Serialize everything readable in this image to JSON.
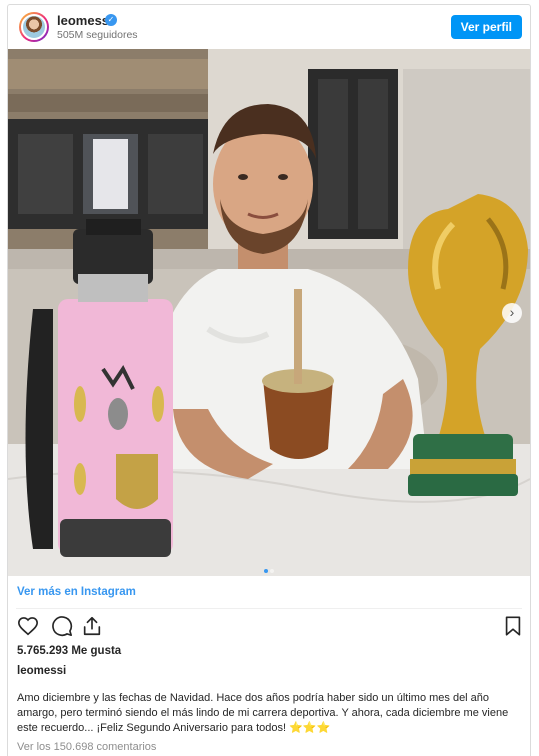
{
  "header": {
    "username": "leomessi",
    "verified_mark": "✓",
    "followers": "505M seguidores",
    "view_profile_label": "Ver perfil"
  },
  "photo": {
    "carousel_next": "›",
    "carousel_total": 2,
    "carousel_index": 1
  },
  "footer": {
    "view_more_label": "Ver más en Instagram",
    "likes": "5.765.293 Me gusta",
    "caption_username": "leomessi",
    "caption": "Amo diciembre y las fechas de Navidad. Hace dos años podría haber sido un último mes del año amargo, pero terminó siendo el más lindo de mi carrera deportiva. Y ahora, cada diciembre me viene este recuerdo... ¡Feliz Segundo Aniversario para todos! ⭐⭐⭐",
    "comments_label": "Ver los 150.698 comentarios"
  },
  "icons": {
    "like": "heart-icon",
    "comment": "comment-icon",
    "share": "share-icon",
    "save": "bookmark-icon"
  },
  "colors": {
    "accent": "#0095f6",
    "link": "#3897f0"
  }
}
